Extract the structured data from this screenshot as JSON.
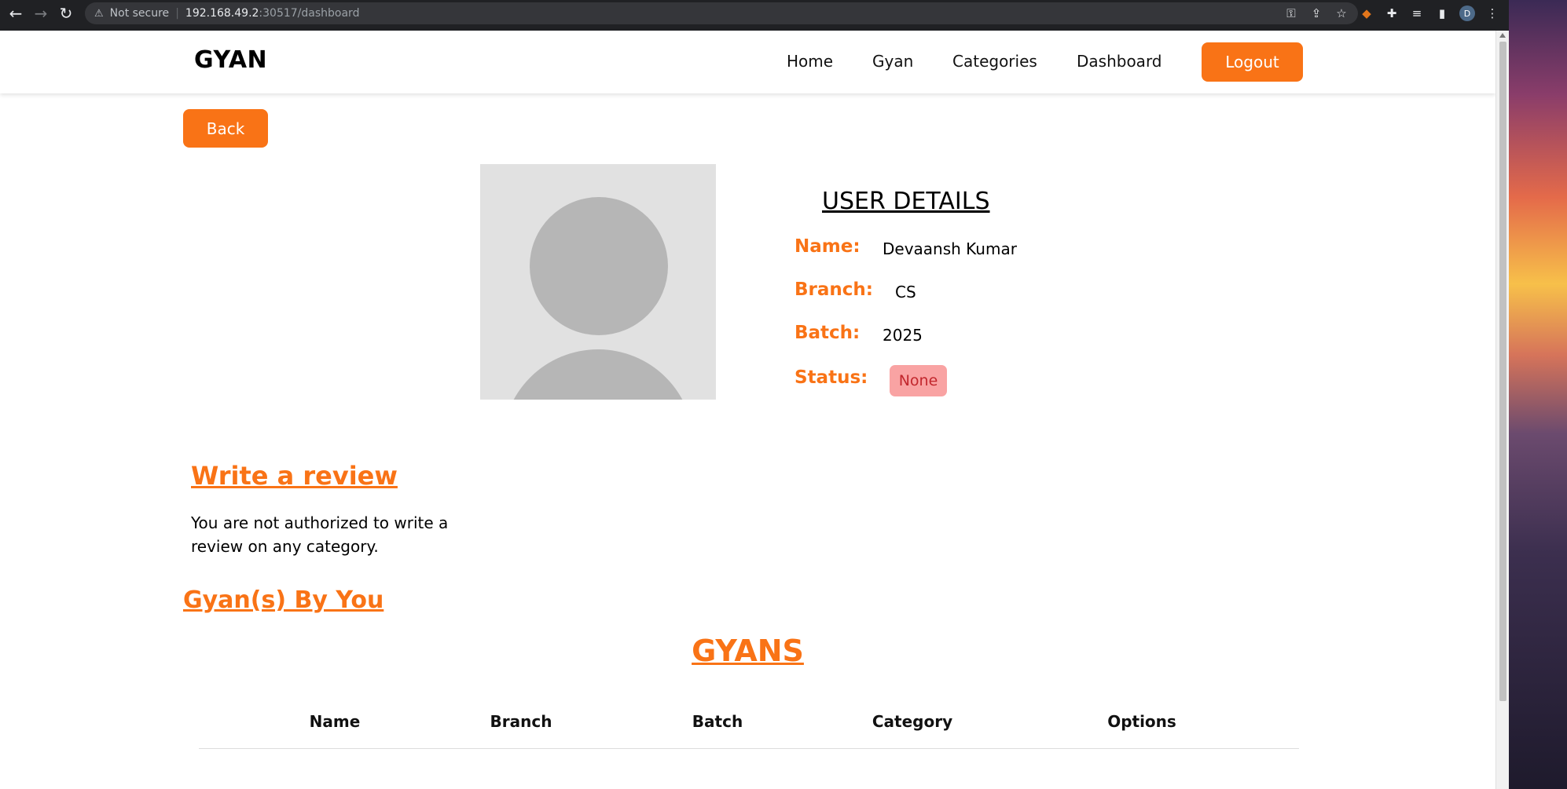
{
  "browser": {
    "security_label": "Not secure",
    "url_host": "192.168.49.2",
    "url_rest": ":30517/dashboard",
    "profile_initial": "D"
  },
  "navbar": {
    "brand": "GYAN",
    "links": [
      "Home",
      "Gyan",
      "Categories",
      "Dashboard"
    ],
    "logout_label": "Logout",
    "accent_color": "#f97316"
  },
  "back_label": "Back",
  "user_details": {
    "title": "USER DETAILS",
    "name_label": "Name:",
    "name_value": "Devaansh Kumar",
    "branch_label": "Branch:",
    "branch_value": "CS",
    "batch_label": "Batch:",
    "batch_value": "2025",
    "status_label": "Status:",
    "status_value": "None"
  },
  "review": {
    "heading": "Write a review",
    "message": "You are not authorized to write a review on any category."
  },
  "gyans_by_you": {
    "heading": "Gyan(s) By You",
    "table_title": "GYANS",
    "columns": [
      "Name",
      "Branch",
      "Batch",
      "Category",
      "Options"
    ]
  }
}
